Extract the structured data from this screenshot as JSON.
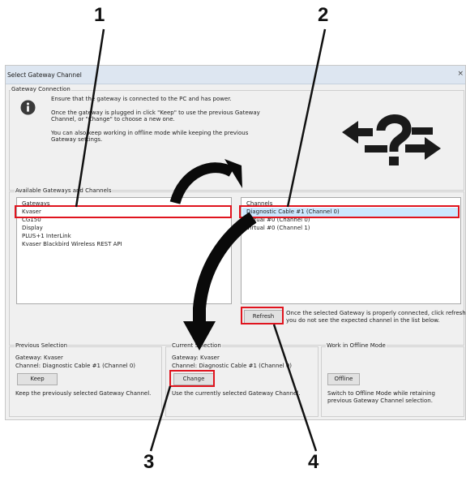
{
  "dialog": {
    "title": "Select Gateway Channel",
    "close_glyph": "×"
  },
  "gateway_connection": {
    "legend": "Gateway Connection",
    "info_lines": [
      "Ensure that the gateway is connected to the PC and has power.",
      "Once the gateway is plugged in click \"Keep\" to use the previous Gateway",
      "Channel, or \"Change\" to choose a new one.",
      "You can also keep working in offline mode while keeping the previous",
      "Gateway settings."
    ]
  },
  "available": {
    "legend": "Available Gateways and Channels",
    "gateways_header": "Gateways",
    "gateways": [
      "Kvaser",
      "CG150",
      "Display",
      "PLUS+1 InterLink",
      "Kvaser Blackbird Wireless REST API"
    ],
    "channels_header": "Channels",
    "channels": [
      "Diagnostic Cable #1 (Channel 0)",
      "Virtual #0 (Channel 0)",
      "Virtual #0 (Channel 1)"
    ],
    "refresh_label": "Refresh",
    "refresh_hint_1": "Once the selected Gateway is properly connected, click refresh if",
    "refresh_hint_2": "you do not see the expected channel in the list below."
  },
  "previous_selection": {
    "legend": "Previous Selection",
    "gateway": "Gateway: Kvaser",
    "channel": "Channel: Diagnostic Cable #1 (Channel 0)",
    "button": "Keep",
    "description": "Keep the previously selected Gateway Channel."
  },
  "current_selection": {
    "legend": "Current Selection",
    "gateway": "Gateway: Kvaser",
    "channel": "Channel: Diagnostic Cable #1 (Channel 0)",
    "button": "Change",
    "description": "Use the currently selected Gateway Channel."
  },
  "offline_mode": {
    "legend": "Work in Offline Mode",
    "button": "Offline",
    "description_1": "Switch to Offline Mode while retaining",
    "description_2": "previous Gateway Channel selection."
  },
  "callouts": [
    "1",
    "2",
    "3",
    "4"
  ],
  "colors": {
    "highlight": "#e0141e",
    "dialog_bg": "#f0f0f0",
    "selected_row": "#cce8ff"
  }
}
